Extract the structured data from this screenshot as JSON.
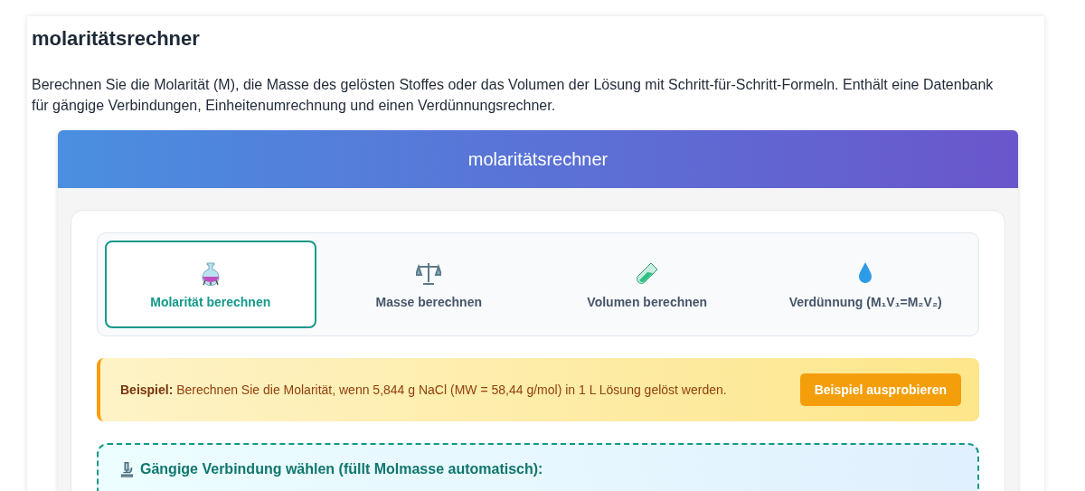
{
  "page": {
    "title": "molaritätsrechner",
    "description": "Berechnen Sie die Molarität (M), die Masse des gelösten Stoffes oder das Volumen der Lösung mit Schritt-für-Schritt-Formeln. Enthält eine Datenbank für gängige Verbindungen, Einheitenumrechnung und einen Verdünnungsrechner."
  },
  "calculator": {
    "header": "molaritätsrechner",
    "tabs": [
      {
        "kind": "flask",
        "label": "Molarität berechnen",
        "selected": true
      },
      {
        "kind": "scale",
        "label": "Masse berechnen",
        "selected": false
      },
      {
        "kind": "tube",
        "label": "Volumen berechnen",
        "selected": false
      },
      {
        "kind": "drop",
        "label": "Verdünnung (M₁V₁=M₂V₂)",
        "selected": false
      }
    ],
    "example": {
      "text": "**Beispiel:** Berechnen Sie die Molarität, wenn 5,844 g NaCl (MW = 58,44 g/mol) in 1 L Lösung gelöst werden.",
      "button": "Beispiel ausprobieren"
    },
    "compounds": {
      "heading": "Gängige Verbindung wählen (füllt Molmasse automatisch):"
    }
  }
}
